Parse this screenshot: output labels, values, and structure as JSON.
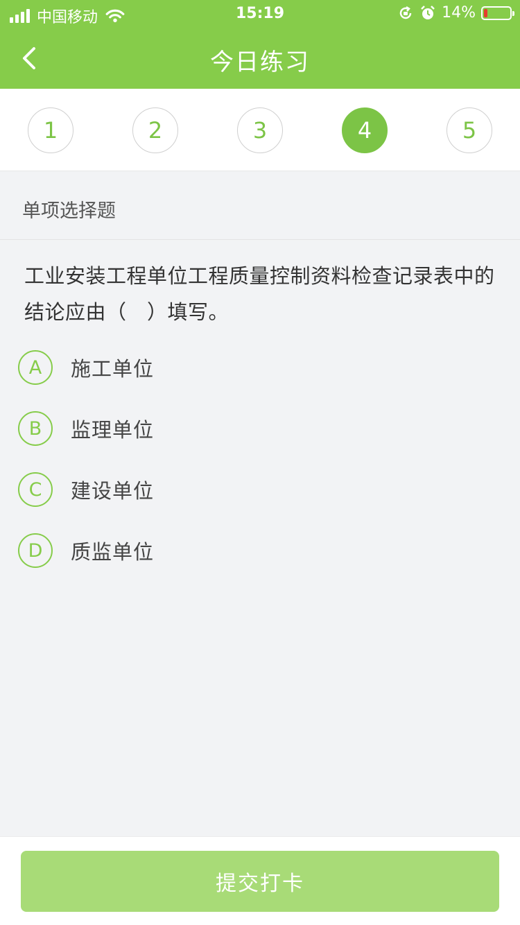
{
  "status_bar": {
    "carrier": "中国移动",
    "time": "15:19",
    "battery_percent": "14%",
    "battery_level": 0.14,
    "battery_color": "#e53c2e",
    "icons": [
      "signal-icon",
      "wifi-icon",
      "orientation-lock-icon",
      "alarm-icon",
      "battery-icon"
    ]
  },
  "header": {
    "title": "今日练习",
    "back_icon": "chevron-left-icon",
    "background": "#86cc4a"
  },
  "question_nav": {
    "items": [
      "1",
      "2",
      "3",
      "4",
      "5"
    ],
    "active_index": 3,
    "accent": "#7cc446"
  },
  "question": {
    "type": "单项选择题",
    "text": "工业安装工程单位工程质量控制资料检查记录表中的结论应由（　）填写。",
    "options": [
      {
        "letter": "A",
        "text": "施工单位"
      },
      {
        "letter": "B",
        "text": "监理单位"
      },
      {
        "letter": "C",
        "text": "建设单位"
      },
      {
        "letter": "D",
        "text": "质监单位"
      }
    ]
  },
  "footer": {
    "submit_label": "提交打卡",
    "submit_color": "#a8db77"
  }
}
